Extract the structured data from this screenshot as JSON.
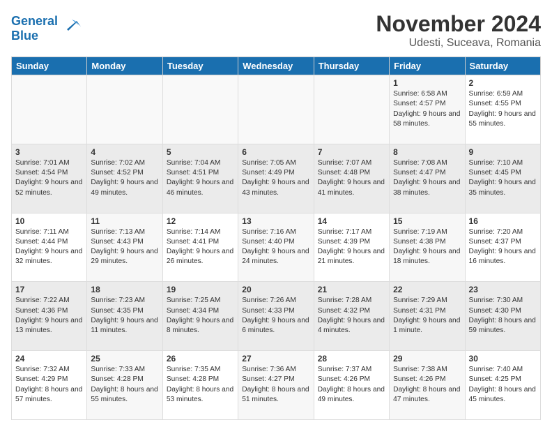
{
  "logo": {
    "line1": "General",
    "line2": "Blue"
  },
  "title": "November 2024",
  "subtitle": "Udesti, Suceava, Romania",
  "headers": [
    "Sunday",
    "Monday",
    "Tuesday",
    "Wednesday",
    "Thursday",
    "Friday",
    "Saturday"
  ],
  "weeks": [
    [
      {
        "day": "",
        "info": ""
      },
      {
        "day": "",
        "info": ""
      },
      {
        "day": "",
        "info": ""
      },
      {
        "day": "",
        "info": ""
      },
      {
        "day": "",
        "info": ""
      },
      {
        "day": "1",
        "info": "Sunrise: 6:58 AM\nSunset: 4:57 PM\nDaylight: 9 hours and 58 minutes."
      },
      {
        "day": "2",
        "info": "Sunrise: 6:59 AM\nSunset: 4:55 PM\nDaylight: 9 hours and 55 minutes."
      }
    ],
    [
      {
        "day": "3",
        "info": "Sunrise: 7:01 AM\nSunset: 4:54 PM\nDaylight: 9 hours and 52 minutes."
      },
      {
        "day": "4",
        "info": "Sunrise: 7:02 AM\nSunset: 4:52 PM\nDaylight: 9 hours and 49 minutes."
      },
      {
        "day": "5",
        "info": "Sunrise: 7:04 AM\nSunset: 4:51 PM\nDaylight: 9 hours and 46 minutes."
      },
      {
        "day": "6",
        "info": "Sunrise: 7:05 AM\nSunset: 4:49 PM\nDaylight: 9 hours and 43 minutes."
      },
      {
        "day": "7",
        "info": "Sunrise: 7:07 AM\nSunset: 4:48 PM\nDaylight: 9 hours and 41 minutes."
      },
      {
        "day": "8",
        "info": "Sunrise: 7:08 AM\nSunset: 4:47 PM\nDaylight: 9 hours and 38 minutes."
      },
      {
        "day": "9",
        "info": "Sunrise: 7:10 AM\nSunset: 4:45 PM\nDaylight: 9 hours and 35 minutes."
      }
    ],
    [
      {
        "day": "10",
        "info": "Sunrise: 7:11 AM\nSunset: 4:44 PM\nDaylight: 9 hours and 32 minutes."
      },
      {
        "day": "11",
        "info": "Sunrise: 7:13 AM\nSunset: 4:43 PM\nDaylight: 9 hours and 29 minutes."
      },
      {
        "day": "12",
        "info": "Sunrise: 7:14 AM\nSunset: 4:41 PM\nDaylight: 9 hours and 26 minutes."
      },
      {
        "day": "13",
        "info": "Sunrise: 7:16 AM\nSunset: 4:40 PM\nDaylight: 9 hours and 24 minutes."
      },
      {
        "day": "14",
        "info": "Sunrise: 7:17 AM\nSunset: 4:39 PM\nDaylight: 9 hours and 21 minutes."
      },
      {
        "day": "15",
        "info": "Sunrise: 7:19 AM\nSunset: 4:38 PM\nDaylight: 9 hours and 18 minutes."
      },
      {
        "day": "16",
        "info": "Sunrise: 7:20 AM\nSunset: 4:37 PM\nDaylight: 9 hours and 16 minutes."
      }
    ],
    [
      {
        "day": "17",
        "info": "Sunrise: 7:22 AM\nSunset: 4:36 PM\nDaylight: 9 hours and 13 minutes."
      },
      {
        "day": "18",
        "info": "Sunrise: 7:23 AM\nSunset: 4:35 PM\nDaylight: 9 hours and 11 minutes."
      },
      {
        "day": "19",
        "info": "Sunrise: 7:25 AM\nSunset: 4:34 PM\nDaylight: 9 hours and 8 minutes."
      },
      {
        "day": "20",
        "info": "Sunrise: 7:26 AM\nSunset: 4:33 PM\nDaylight: 9 hours and 6 minutes."
      },
      {
        "day": "21",
        "info": "Sunrise: 7:28 AM\nSunset: 4:32 PM\nDaylight: 9 hours and 4 minutes."
      },
      {
        "day": "22",
        "info": "Sunrise: 7:29 AM\nSunset: 4:31 PM\nDaylight: 9 hours and 1 minute."
      },
      {
        "day": "23",
        "info": "Sunrise: 7:30 AM\nSunset: 4:30 PM\nDaylight: 8 hours and 59 minutes."
      }
    ],
    [
      {
        "day": "24",
        "info": "Sunrise: 7:32 AM\nSunset: 4:29 PM\nDaylight: 8 hours and 57 minutes."
      },
      {
        "day": "25",
        "info": "Sunrise: 7:33 AM\nSunset: 4:28 PM\nDaylight: 8 hours and 55 minutes."
      },
      {
        "day": "26",
        "info": "Sunrise: 7:35 AM\nSunset: 4:28 PM\nDaylight: 8 hours and 53 minutes."
      },
      {
        "day": "27",
        "info": "Sunrise: 7:36 AM\nSunset: 4:27 PM\nDaylight: 8 hours and 51 minutes."
      },
      {
        "day": "28",
        "info": "Sunrise: 7:37 AM\nSunset: 4:26 PM\nDaylight: 8 hours and 49 minutes."
      },
      {
        "day": "29",
        "info": "Sunrise: 7:38 AM\nSunset: 4:26 PM\nDaylight: 8 hours and 47 minutes."
      },
      {
        "day": "30",
        "info": "Sunrise: 7:40 AM\nSunset: 4:25 PM\nDaylight: 8 hours and 45 minutes."
      }
    ]
  ]
}
